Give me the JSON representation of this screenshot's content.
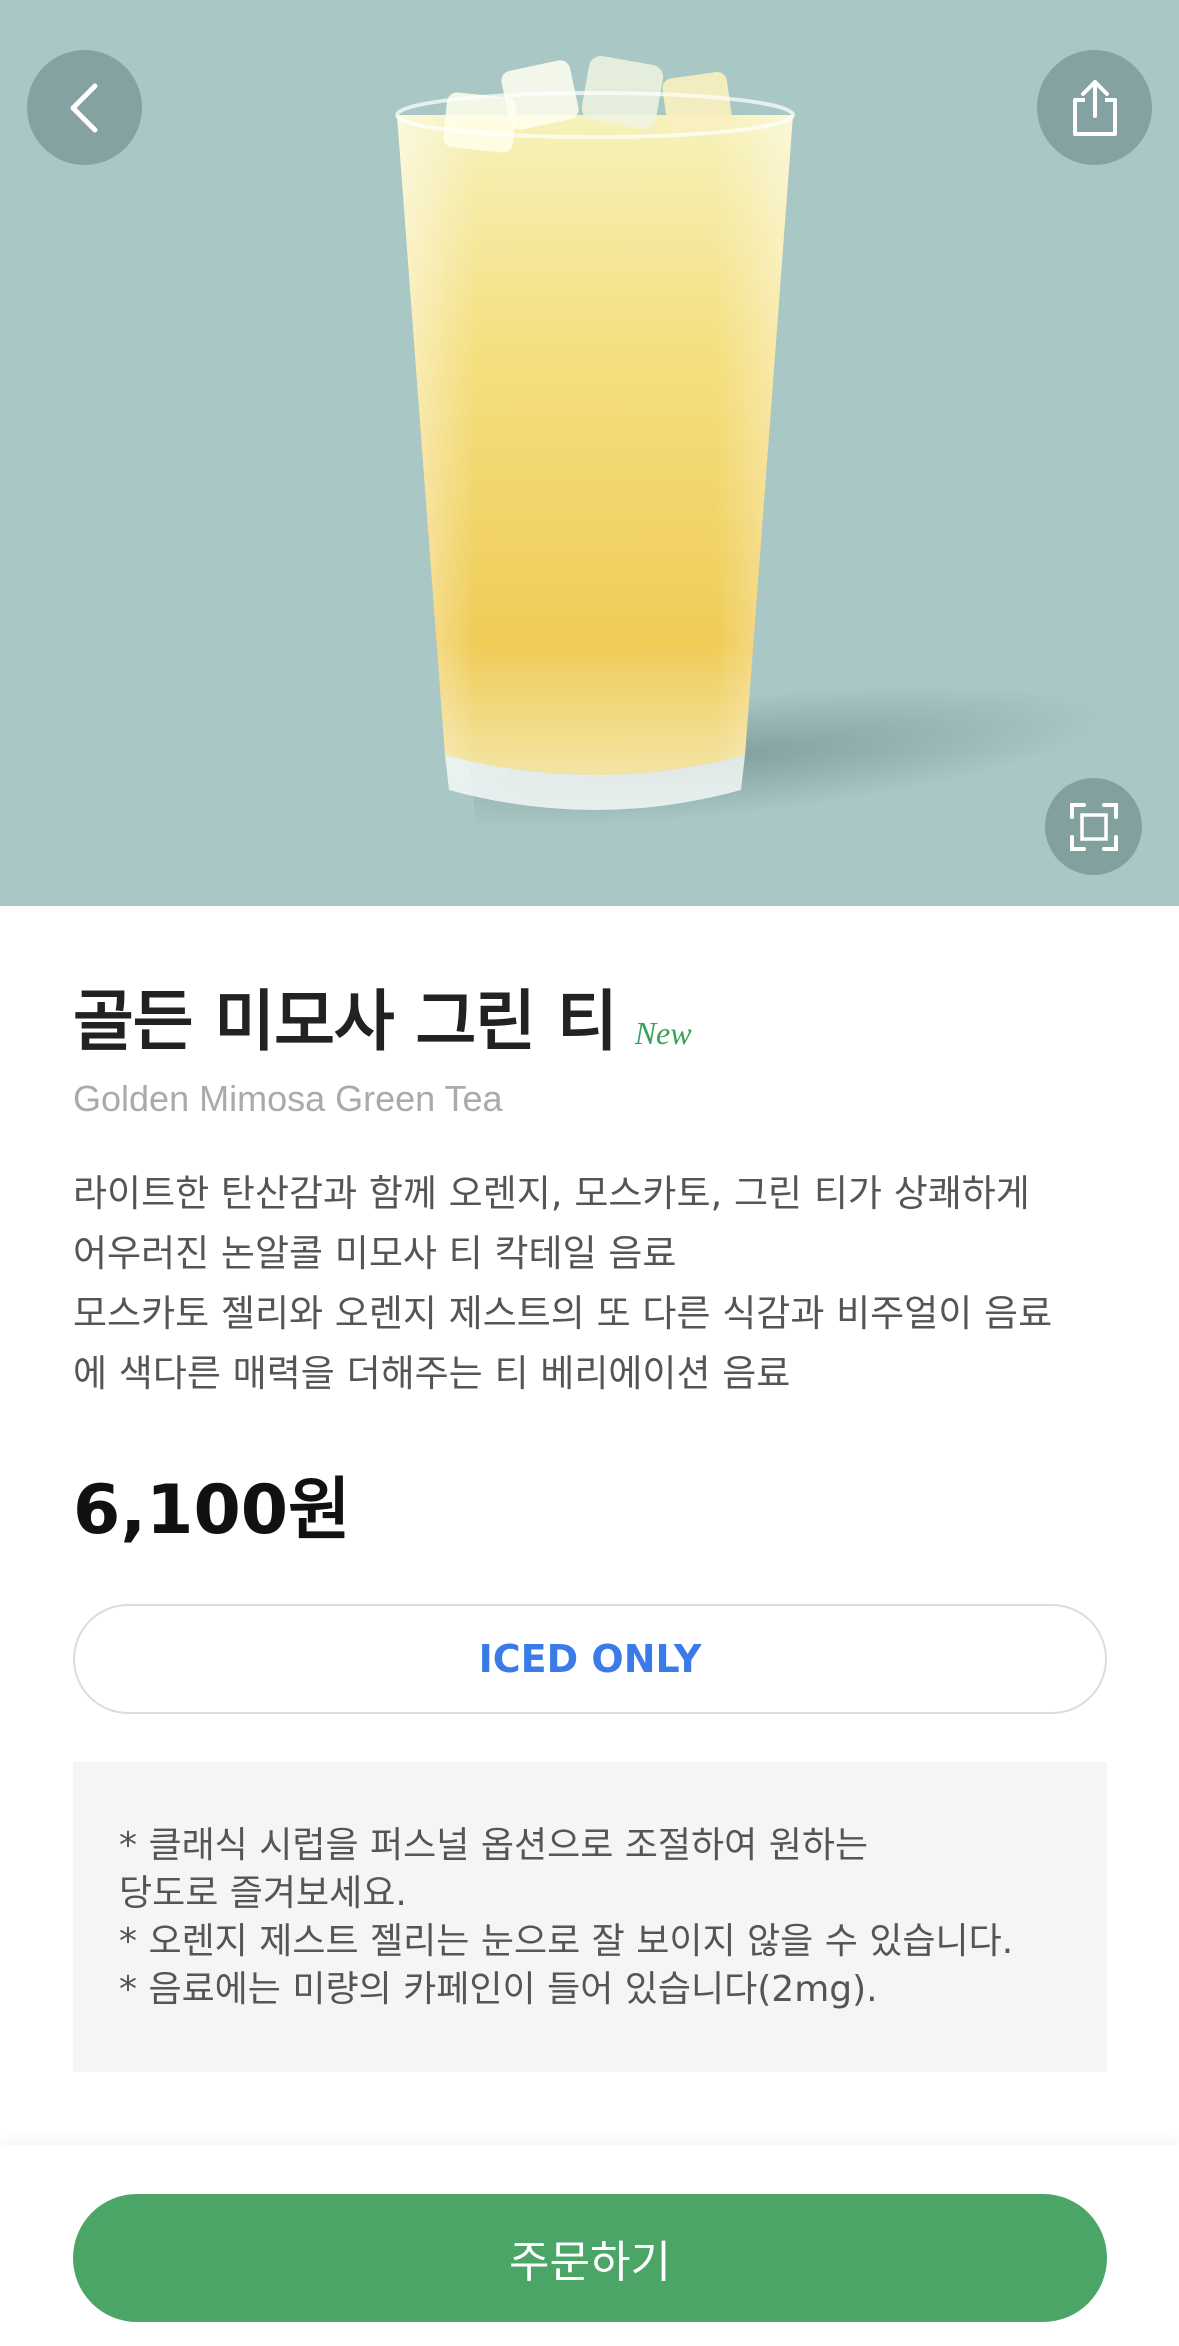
{
  "hero": {
    "back_icon": "chevron-left-icon",
    "share_icon": "share-icon",
    "zoom_icon": "expand-icon",
    "background": "#a9c8c5"
  },
  "product": {
    "name_ko": "골든 미모사 그린 티",
    "badge": "New",
    "name_en": "Golden Mimosa Green Tea",
    "description_lines": [
      "라이트한 탄산감과 함께 오렌지, 모스카토, 그린 티가 상쾌하게",
      "어우러진 논알콜 미모사 티 칵테일 음료",
      "모스카토 젤리와 오렌지 제스트의 또 다른 식감과 비주얼이 음료",
      "에 색다른 매력을 더해주는 티 베리에이션 음료"
    ],
    "price": "6,100원",
    "temperature": "ICED ONLY"
  },
  "notice_lines": [
    "* 클래식 시럽을 퍼스널 옵션으로 조절하여 원하는",
    "당도로 즐겨보세요.",
    "* 오렌지 제스트 젤리는 눈으로 잘 보이지 않을 수 있습니다.",
    "* 음료에는 미량의 카페인이 들어 있습니다(2mg)."
  ],
  "order_button": "주문하기",
  "colors": {
    "accent_green": "#4aa567",
    "new_badge": "#3aa05a",
    "iced_blue": "#3b7be8"
  }
}
